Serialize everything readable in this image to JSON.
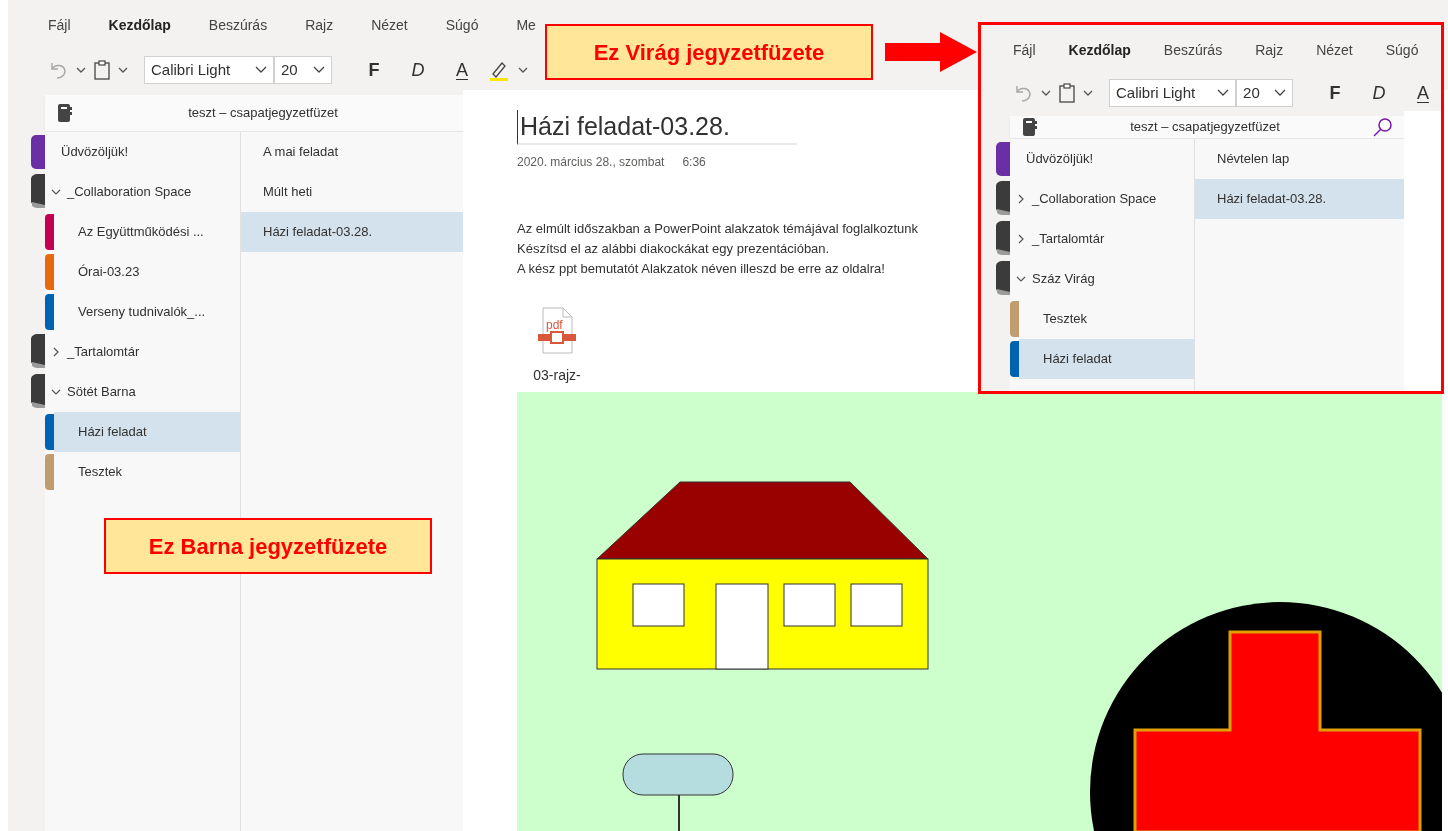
{
  "main": {
    "ribbon": {
      "tabs": [
        {
          "label": "Fájl",
          "selected": false
        },
        {
          "label": "Kezdőlap",
          "selected": true
        },
        {
          "label": "Beszúrás",
          "selected": false
        },
        {
          "label": "Rajz",
          "selected": false
        },
        {
          "label": "Nézet",
          "selected": false
        },
        {
          "label": "Súgó",
          "selected": false
        },
        {
          "label": "Me",
          "selected": false
        }
      ],
      "font": "Calibri Light",
      "size": "20",
      "format_keys": [
        {
          "label": "F",
          "kind": "bold"
        },
        {
          "label": "D",
          "kind": "italic"
        },
        {
          "label": "A",
          "kind": "font_color"
        }
      ]
    },
    "notebook": {
      "title": "teszt – csapatjegyzetfüzet",
      "sections": [
        {
          "label": "Üdvözöljük!",
          "kind": "section",
          "color": "#6b2fa5",
          "selected": false
        },
        {
          "label": "_Collaboration Space",
          "kind": "group",
          "expanded": true,
          "children": [
            {
              "label": "Az Együttműködési ...",
              "kind": "section",
              "color": "#c30052",
              "selected": false
            },
            {
              "label": "Órai-03.23",
              "kind": "section",
              "color": "#e8680f",
              "selected": false
            },
            {
              "label": "Verseny tudnivalók_...",
              "kind": "section",
              "color": "#0063b1",
              "selected": false
            }
          ]
        },
        {
          "label": "_Tartalomtár",
          "kind": "group",
          "expanded": false
        },
        {
          "label": "Sötét Barna",
          "kind": "group",
          "expanded": true,
          "children": [
            {
              "label": "Házi feladat",
              "kind": "section",
              "color": "#0063b1",
              "selected": true
            },
            {
              "label": "Tesztek",
              "kind": "section",
              "color": "#c19c6f",
              "selected": false
            }
          ]
        }
      ],
      "pages": [
        {
          "label": "A mai feladat",
          "selected": false
        },
        {
          "label": "Múlt heti",
          "selected": false
        },
        {
          "label": "Házi feladat-03.28.",
          "selected": true
        }
      ]
    }
  },
  "page": {
    "title": "Házi feladat-03.28.",
    "date": "2020. március 28., szombat",
    "time": "6:36",
    "paragraphs": [
      "Az elmúlt időszakban a PowerPoint alakzatok témájával foglalkoztunk",
      "Készítsd el az alábbi diakockákat egy prezentációban.",
      "A kész ppt bemutatót Alakzatok néven illeszd be erre az oldalra!"
    ],
    "attachment": {
      "icon_label": "pdf",
      "name": "03-rajz-"
    }
  },
  "inset": {
    "ribbon": {
      "tabs": [
        {
          "label": "Fájl",
          "selected": false
        },
        {
          "label": "Kezdőlap",
          "selected": true
        },
        {
          "label": "Beszúrás",
          "selected": false
        },
        {
          "label": "Rajz",
          "selected": false
        },
        {
          "label": "Nézet",
          "selected": false
        },
        {
          "label": "Súgó",
          "selected": false
        }
      ],
      "font": "Calibri Light",
      "size": "20",
      "format_keys": [
        {
          "label": "F",
          "kind": "bold"
        },
        {
          "label": "D",
          "kind": "italic"
        },
        {
          "label": "A",
          "kind": "font_color"
        }
      ]
    },
    "notebook": {
      "title": "teszt – csapatjegyzetfüzet",
      "sections": [
        {
          "label": "Üdvözöljük!",
          "kind": "section",
          "color": "#6b2fa5",
          "selected": false
        },
        {
          "label": "_Collaboration Space",
          "kind": "group",
          "expanded": false
        },
        {
          "label": "_Tartalomtár",
          "kind": "group",
          "expanded": false
        },
        {
          "label": "Száz Virág",
          "kind": "group",
          "expanded": true,
          "children": [
            {
              "label": "Tesztek",
              "kind": "section",
              "color": "#c19c6f",
              "selected": false
            },
            {
              "label": "Házi feladat",
              "kind": "section",
              "color": "#0063b1",
              "selected": true
            }
          ]
        }
      ],
      "pages": [
        {
          "label": "Névtelen lap",
          "selected": false
        },
        {
          "label": "Házi feladat-03.28.",
          "selected": true
        }
      ]
    }
  },
  "callouts": [
    {
      "text": "Ez Virág jegyzetfüzete",
      "kind": "arrow"
    },
    {
      "text": "Ez Barna jegyzetfüzete",
      "kind": "plain"
    }
  ]
}
